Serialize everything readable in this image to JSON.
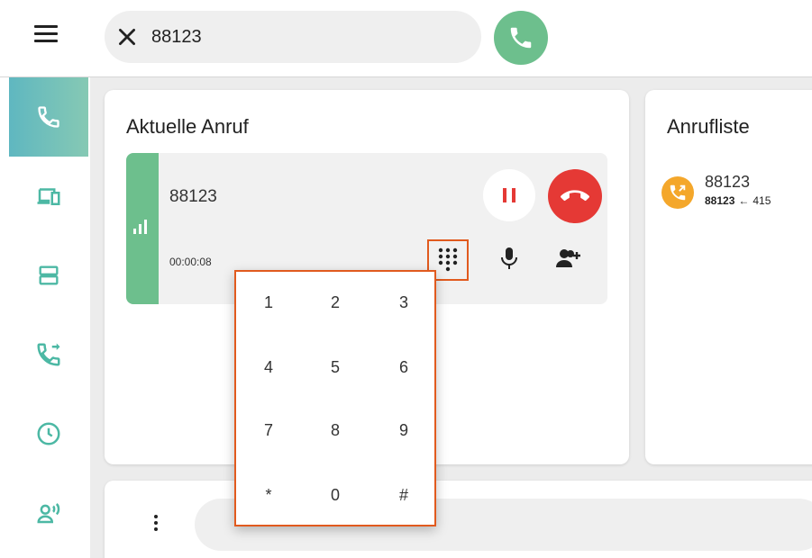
{
  "search": {
    "value": "88123"
  },
  "current_calls": {
    "title": "Aktuelle Anruf",
    "call": {
      "number": "88123",
      "duration": "00:00:08"
    }
  },
  "call_list": {
    "title": "Anrufliste",
    "entries": [
      {
        "number": "88123",
        "from": "88123",
        "direction_arrow": "←",
        "to": "415"
      }
    ]
  },
  "dialpad": {
    "keys": [
      "1",
      "2",
      "3",
      "4",
      "5",
      "6",
      "7",
      "8",
      "9",
      "*",
      "0",
      "#"
    ]
  },
  "colors": {
    "accent_green": "#6dbf8d",
    "hangup_red": "#e53935",
    "hold_red": "#e53935",
    "highlight_orange": "#e15a1e",
    "avatar_orange": "#f4a72b",
    "sidebar_teal": "#4cb8a4"
  },
  "icons": {
    "menu": "hamburger-menu-icon",
    "clear": "close-icon",
    "call": "phone-icon",
    "sidebar": [
      "phone-icon",
      "devices-icon",
      "server-icon",
      "call-forward-icon",
      "clock-icon",
      "voice-person-icon"
    ],
    "hold": "pause-icon",
    "hangup": "call-end-icon",
    "dialpad": "dialpad-icon",
    "mic": "microphone-icon",
    "add_person": "add-person-icon",
    "signal": "signal-bars-icon",
    "list_avatar": "outgoing-call-icon",
    "more": "more-vertical-icon"
  }
}
